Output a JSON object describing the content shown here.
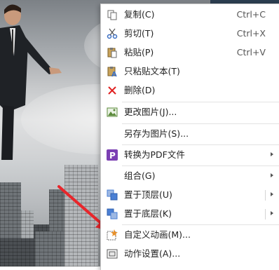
{
  "menu": {
    "items": [
      {
        "label": "复制(C)",
        "shortcut": "Ctrl+C",
        "icon": "copy-icon"
      },
      {
        "label": "剪切(T)",
        "shortcut": "Ctrl+X",
        "icon": "scissors-icon"
      },
      {
        "label": "粘贴(P)",
        "shortcut": "Ctrl+V",
        "icon": "paste-icon"
      },
      {
        "label": "只粘贴文本(T)",
        "icon": "paste-text-icon"
      },
      {
        "label": "删除(D)",
        "icon": "delete-x-icon"
      },
      {
        "label": "更改图片(J)...",
        "icon": "change-picture-icon"
      },
      {
        "label": "另存为图片(S)..."
      },
      {
        "label": "转换为PDF文件",
        "icon": "pdf-icon",
        "submenu": true
      },
      {
        "label": "组合(G)",
        "submenu": true
      },
      {
        "label": "置于顶层(U)",
        "icon": "bring-to-front-icon",
        "submenu": true
      },
      {
        "label": "置于底层(K)",
        "icon": "send-to-back-icon",
        "submenu": true
      },
      {
        "label": "自定义动画(M)...",
        "icon": "custom-animation-icon"
      },
      {
        "label": "动作设置(A)...",
        "icon": "action-settings-icon"
      }
    ]
  },
  "colors": {
    "menu_bg": "#ffffff",
    "pdf_purple": "#7b3fb3",
    "delete_red": "#e02020",
    "arrow_red": "#e8262b",
    "layer_blue": "#4a7fd4"
  }
}
